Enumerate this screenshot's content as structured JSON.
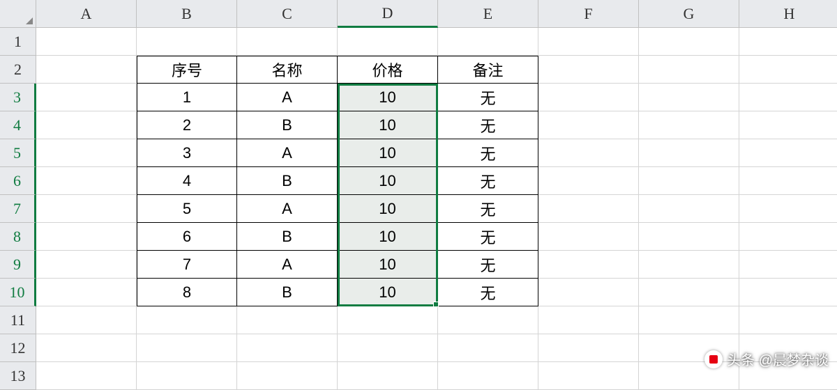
{
  "columns": [
    "A",
    "B",
    "C",
    "D",
    "E",
    "F",
    "G",
    "H"
  ],
  "rows": [
    "1",
    "2",
    "3",
    "4",
    "5",
    "6",
    "7",
    "8",
    "9",
    "10",
    "11",
    "12",
    "13"
  ],
  "selectedColumn": "D",
  "table": {
    "headers": {
      "seq": "序号",
      "name": "名称",
      "price": "价格",
      "note": "备注"
    },
    "rows": [
      {
        "seq": "1",
        "name": "A",
        "price": "10",
        "note": "无"
      },
      {
        "seq": "2",
        "name": "B",
        "price": "10",
        "note": "无"
      },
      {
        "seq": "3",
        "name": "A",
        "price": "10",
        "note": "无"
      },
      {
        "seq": "4",
        "name": "B",
        "price": "10",
        "note": "无"
      },
      {
        "seq": "5",
        "name": "A",
        "price": "10",
        "note": "无"
      },
      {
        "seq": "6",
        "name": "B",
        "price": "10",
        "note": "无"
      },
      {
        "seq": "7",
        "name": "A",
        "price": "10",
        "note": "无"
      },
      {
        "seq": "8",
        "name": "B",
        "price": "10",
        "note": "无"
      }
    ]
  },
  "watermark": {
    "text": "头条 @晨梦杂谈"
  }
}
